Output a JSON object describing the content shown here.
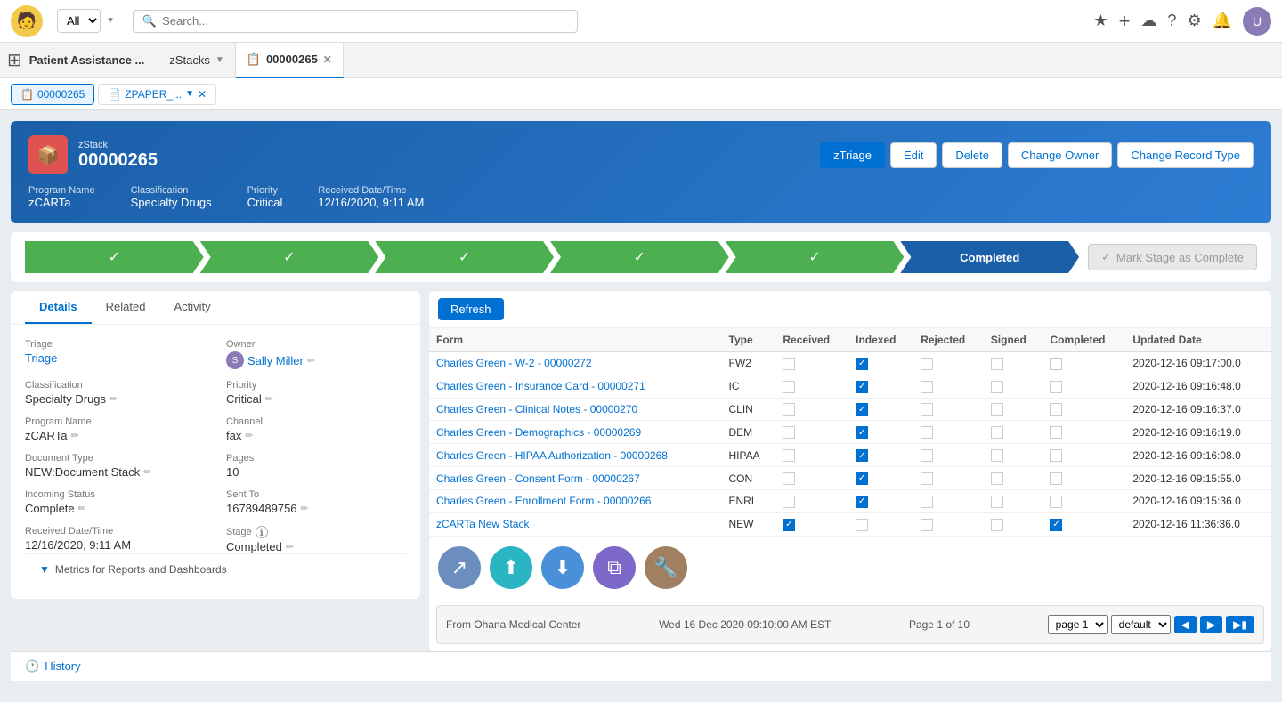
{
  "app": {
    "logo_emoji": "🧑",
    "title": "Patient Assistance ...",
    "search_placeholder": "Search...",
    "search_scope": "All"
  },
  "tabs": [
    {
      "id": "zstacks",
      "label": "zStacks",
      "active": false,
      "closeable": false,
      "has_dropdown": true
    },
    {
      "id": "record",
      "label": "00000265",
      "active": true,
      "closeable": true,
      "has_dropdown": false
    }
  ],
  "record_tabs": [
    {
      "id": "main",
      "label": "00000265",
      "icon": "📋",
      "active": true
    },
    {
      "id": "zpaper",
      "label": "ZPAPER_...",
      "icon": "📄",
      "active": false,
      "closeable": true
    }
  ],
  "record": {
    "icon_emoji": "📦",
    "icon_color": "#e05252",
    "subtitle": "zStack",
    "id": "00000265",
    "actions": [
      {
        "id": "ztriage",
        "label": "zTriage",
        "primary": false
      },
      {
        "id": "edit",
        "label": "Edit",
        "primary": false
      },
      {
        "id": "delete",
        "label": "Delete",
        "primary": false
      },
      {
        "id": "change_owner",
        "label": "Change Owner",
        "primary": false
      },
      {
        "id": "change_record_type",
        "label": "Change Record Type",
        "primary": false
      }
    ],
    "meta": [
      {
        "id": "program_name",
        "label": "Program Name",
        "value": "zCARTa"
      },
      {
        "id": "classification",
        "label": "Classification",
        "value": "Specialty Drugs"
      },
      {
        "id": "priority",
        "label": "Priority",
        "value": "Critical"
      },
      {
        "id": "received_date",
        "label": "Received Date/Time",
        "value": "12/16/2020, 9:11 AM"
      }
    ]
  },
  "stages": [
    {
      "id": "s1",
      "completed": true,
      "label": "✓"
    },
    {
      "id": "s2",
      "completed": true,
      "label": "✓"
    },
    {
      "id": "s3",
      "completed": true,
      "label": "✓"
    },
    {
      "id": "s4",
      "completed": true,
      "label": "✓"
    },
    {
      "id": "s5",
      "completed": true,
      "label": "✓"
    },
    {
      "id": "s6",
      "completed": true,
      "label": "Completed",
      "is_named": true
    }
  ],
  "mark_complete": {
    "label": "Mark Stage as Complete",
    "icon": "✓"
  },
  "detail_tabs": [
    {
      "id": "details",
      "label": "Details",
      "active": true
    },
    {
      "id": "related",
      "label": "Related",
      "active": false
    },
    {
      "id": "activity",
      "label": "Activity",
      "active": false
    }
  ],
  "fields": {
    "triage": {
      "label": "Triage",
      "value": "Triage",
      "is_link": true
    },
    "owner": {
      "label": "Owner",
      "value": "Sally Miller"
    },
    "classification": {
      "label": "Classification",
      "value": "Specialty Drugs"
    },
    "priority": {
      "label": "Priority",
      "value": "Critical"
    },
    "program_name": {
      "label": "Program Name",
      "value": "zCARTa"
    },
    "channel": {
      "label": "Channel",
      "value": "fax"
    },
    "document_type": {
      "label": "Document Type",
      "value": "NEW:Document Stack"
    },
    "pages": {
      "label": "Pages",
      "value": "10"
    },
    "incoming_status": {
      "label": "Incoming Status",
      "value": "Complete"
    },
    "sent_to": {
      "label": "Sent To",
      "value": "16789489756"
    },
    "received_date": {
      "label": "Received Date/Time",
      "value": "12/16/2020, 9:11 AM"
    },
    "stage": {
      "label": "Stage",
      "value": "Completed"
    }
  },
  "table": {
    "refresh_label": "Refresh",
    "columns": [
      "Form",
      "Type",
      "Received",
      "Indexed",
      "Rejected",
      "Signed",
      "Completed",
      "Updated Date"
    ],
    "rows": [
      {
        "id": "r1",
        "form": "Charles Green - W-2 - 00000272",
        "type": "FW2",
        "received": false,
        "indexed": true,
        "rejected": false,
        "signed": false,
        "completed": false,
        "updated": "2020-12-16 09:17:00.0"
      },
      {
        "id": "r2",
        "form": "Charles Green - Insurance Card - 00000271",
        "type": "IC",
        "received": false,
        "indexed": true,
        "rejected": false,
        "signed": false,
        "completed": false,
        "updated": "2020-12-16 09:16:48.0"
      },
      {
        "id": "r3",
        "form": "Charles Green - Clinical Notes - 00000270",
        "type": "CLIN",
        "received": false,
        "indexed": true,
        "rejected": false,
        "signed": false,
        "completed": false,
        "updated": "2020-12-16 09:16:37.0"
      },
      {
        "id": "r4",
        "form": "Charles Green - Demographics - 00000269",
        "type": "DEM",
        "received": false,
        "indexed": true,
        "rejected": false,
        "signed": false,
        "completed": false,
        "updated": "2020-12-16 09:16:19.0"
      },
      {
        "id": "r5",
        "form": "Charles Green - HIPAA Authorization - 00000268",
        "type": "HIPAA",
        "received": false,
        "indexed": true,
        "rejected": false,
        "signed": false,
        "completed": false,
        "updated": "2020-12-16 09:16:08.0"
      },
      {
        "id": "r6",
        "form": "Charles Green - Consent Form - 00000267",
        "type": "CON",
        "received": false,
        "indexed": true,
        "rejected": false,
        "signed": false,
        "completed": false,
        "updated": "2020-12-16 09:15:55.0"
      },
      {
        "id": "r7",
        "form": "Charles Green - Enrollment Form - 00000266",
        "type": "ENRL",
        "received": false,
        "indexed": true,
        "rejected": false,
        "signed": false,
        "completed": false,
        "updated": "2020-12-16 09:15:36.0"
      },
      {
        "id": "r8",
        "form": "zCARTa New Stack",
        "type": "NEW",
        "received": true,
        "indexed": false,
        "rejected": false,
        "signed": false,
        "completed": true,
        "updated": "2020-12-16 11:36:36.0"
      }
    ]
  },
  "action_icons": [
    {
      "id": "share",
      "emoji": "↗",
      "color": "#6c8ebf",
      "title": "Share"
    },
    {
      "id": "upload",
      "emoji": "⬆",
      "color": "#2ab5c3",
      "title": "Upload"
    },
    {
      "id": "download",
      "emoji": "⬇",
      "color": "#4a90d9",
      "title": "Download"
    },
    {
      "id": "copy",
      "emoji": "⧉",
      "color": "#7b68c8",
      "title": "Copy"
    },
    {
      "id": "settings2",
      "emoji": "🔧",
      "color": "#a08060",
      "title": "Settings"
    }
  ],
  "doc_preview": {
    "from": "From Ohana Medical Center",
    "date": "Wed 16 Dec 2020 09:10:00 AM EST",
    "page_info": "Page 1 of 10",
    "page_select_default": "page 1",
    "view_select_default": "default"
  },
  "metrics": {
    "label": "Metrics for Reports and Dashboards",
    "arrow": "▼"
  },
  "history": {
    "label": "History",
    "icon": "🕐"
  },
  "nav_icons": {
    "star": "★",
    "add": "+",
    "bell": "🔔",
    "settings": "⚙",
    "help": "?",
    "apps": "⊞"
  }
}
